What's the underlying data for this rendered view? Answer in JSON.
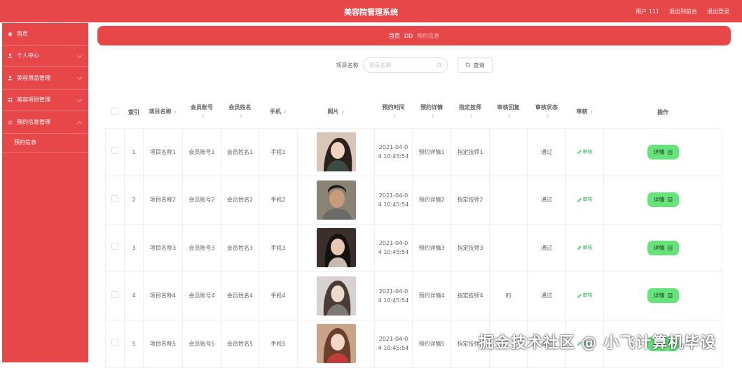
{
  "app": {
    "title": "美容院管理系统",
    "user": "用户 111",
    "back_to_front": "退出到前台",
    "logout": "退出登录"
  },
  "sidebar": {
    "items": [
      {
        "label": "首页",
        "icon": "home-icon"
      },
      {
        "label": "个人中心",
        "icon": "user-icon"
      },
      {
        "label": "美容用品管理",
        "icon": "user-icon"
      },
      {
        "label": "美容项目管理",
        "icon": "grid-icon"
      },
      {
        "label": "预约信息管理",
        "icon": "star-icon"
      }
    ],
    "sub_items": [
      {
        "label": "预约信息"
      }
    ]
  },
  "breadcrumb": {
    "home": "首页",
    "separator": "DD",
    "current": "预约信息"
  },
  "search": {
    "label": "项目名称",
    "placeholder": "项目名称",
    "query_button": "查询"
  },
  "table": {
    "columns": [
      "索引",
      "项目名称",
      "会员账号",
      "会员姓名",
      "手机",
      "照片",
      "预约时间",
      "预约详情",
      "指定技师",
      "审核回复",
      "审核状态",
      "审核",
      "操作"
    ],
    "audit_label": "审核",
    "detail_label": "详情",
    "rows": [
      {
        "index": "1",
        "name": "项目名称1",
        "account": "会员账号1",
        "member": "会员姓名1",
        "phone": "手机1",
        "time_line1": "2021-04-0",
        "time_line2": "4 10:45:54",
        "detail": "预约详情1",
        "tech": "指定技师1",
        "reply": "",
        "status": "通过"
      },
      {
        "index": "2",
        "name": "项目名称2",
        "account": "会员账号2",
        "member": "会员姓名2",
        "phone": "手机2",
        "time_line1": "2021-04-0",
        "time_line2": "4 10:45:54",
        "detail": "预约详情2",
        "tech": "指定技师2",
        "reply": "",
        "status": "通过"
      },
      {
        "index": "3",
        "name": "项目名称3",
        "account": "会员账号3",
        "member": "会员姓名3",
        "phone": "手机3",
        "time_line1": "2021-04-0",
        "time_line2": "4 10:45:54",
        "detail": "预约详情3",
        "tech": "指定技师3",
        "reply": "",
        "status": "通过"
      },
      {
        "index": "4",
        "name": "项目名称4",
        "account": "会员账号4",
        "member": "会员姓名4",
        "phone": "手机4",
        "time_line1": "2021-04-0",
        "time_line2": "4 10:45:54",
        "detail": "预约详情4",
        "tech": "指定技师4",
        "reply": "的",
        "status": "通过"
      },
      {
        "index": "5",
        "name": "项目名称5",
        "account": "会员账号5",
        "member": "会员姓名5",
        "phone": "手机5",
        "time_line1": "2021-04-0",
        "time_line2": "4 10:45:54",
        "detail": "预约详情5",
        "tech": "指定技师5",
        "reply": "",
        "status": "通过"
      }
    ]
  },
  "watermark": "掘金技术社区 @ 小飞计算机毕设",
  "colors": {
    "primary": "#e8474a",
    "detail_button": "#67e37c",
    "audit_link": "#27b24d"
  }
}
